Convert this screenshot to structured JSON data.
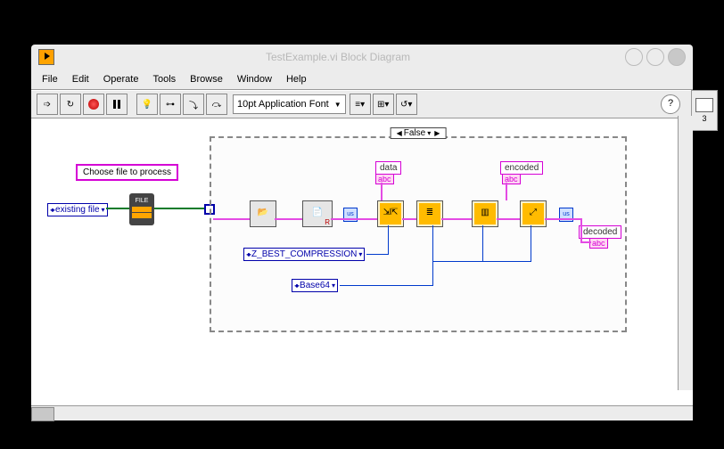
{
  "window": {
    "title": "TestExample.vi Block Diagram"
  },
  "menu": [
    "File",
    "Edit",
    "Operate",
    "Tools",
    "Browse",
    "Window",
    "Help"
  ],
  "toolbar": {
    "font": "10pt Application Font",
    "help_label": "?",
    "iteration": "3"
  },
  "diagram": {
    "comment": "Choose file to process",
    "file_mode": "existing file",
    "case_value": "False",
    "labels": {
      "data": "data",
      "encoded": "encoded",
      "decoded": "decoded"
    },
    "abc": "abc",
    "constants": {
      "compression": "Z_BEST_COMPRESSION",
      "encoding": "Base64"
    },
    "us": "us",
    "file_node_text": "FILE",
    "read_marker": "R",
    "nodes": [
      "file-dialog",
      "open-file",
      "read-file",
      "string-to-byte",
      "compress",
      "flatten",
      "encode-base64",
      "decode",
      "write-file",
      "byte-to-string"
    ]
  }
}
